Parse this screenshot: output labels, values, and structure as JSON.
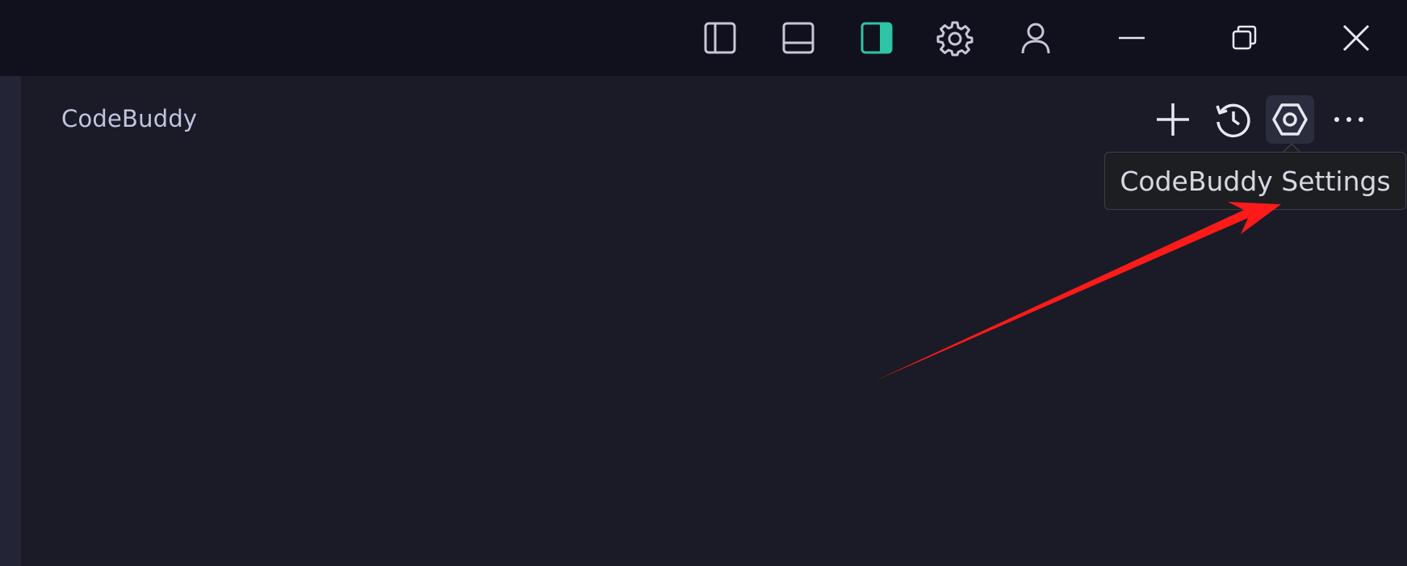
{
  "window": {
    "toolbar_icons": [
      "toggle-primary-sidebar-icon",
      "toggle-panel-icon",
      "toggle-secondary-sidebar-icon",
      "settings-gear-icon",
      "accounts-icon",
      "minimize-icon",
      "restore-icon",
      "close-icon"
    ],
    "active_toggle_color": "#2ec4a6"
  },
  "panel": {
    "title": "CodeBuddy",
    "action_icons": [
      "plus-icon",
      "history-icon",
      "settings-hex-icon",
      "more-icon"
    ]
  },
  "tooltip": {
    "text": "CodeBuddy Settings"
  },
  "annotation": {
    "arrow_color": "#ff1a1a"
  }
}
